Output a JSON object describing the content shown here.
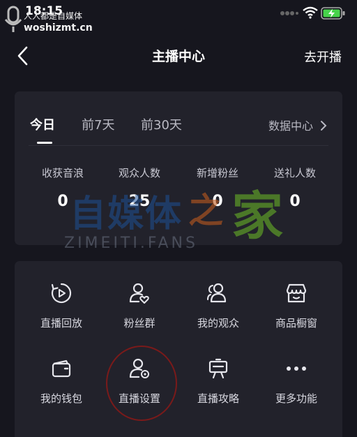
{
  "status_bar": {
    "time": "18:15",
    "watermark_line1": "人人都是自媒体",
    "watermark_line2": "woshizmt.cn"
  },
  "nav": {
    "title": "主播中心",
    "action_label": "去开播"
  },
  "stats_card": {
    "tabs": [
      {
        "label": "今日",
        "active": true
      },
      {
        "label": "前7天",
        "active": false
      },
      {
        "label": "前30天",
        "active": false
      }
    ],
    "data_center_label": "数据中心",
    "stats": [
      {
        "label": "收获音浪",
        "value": "0"
      },
      {
        "label": "观众人数",
        "value": "25"
      },
      {
        "label": "新增粉丝",
        "value": "0"
      },
      {
        "label": "送礼人数",
        "value": "0"
      }
    ]
  },
  "tools": [
    {
      "label": "直播回放",
      "icon": "play-circle-icon"
    },
    {
      "label": "粉丝群",
      "icon": "user-heart-icon"
    },
    {
      "label": "我的观众",
      "icon": "users-icon"
    },
    {
      "label": "商品橱窗",
      "icon": "store-icon"
    },
    {
      "label": "我的钱包",
      "icon": "wallet-icon"
    },
    {
      "label": "直播设置",
      "icon": "user-gear-icon"
    },
    {
      "label": "直播攻略",
      "icon": "easel-icon"
    },
    {
      "label": "更多功能",
      "icon": "more-dots-icon"
    }
  ],
  "watermark": {
    "text_main": "自媒体",
    "text_zhi": "之",
    "text_jia": "家",
    "text_sub": "ZIMEITI.FANS"
  },
  "colors": {
    "background": "#16161e",
    "card": "#22222b",
    "circle_annotation": "#7a1a1a"
  }
}
